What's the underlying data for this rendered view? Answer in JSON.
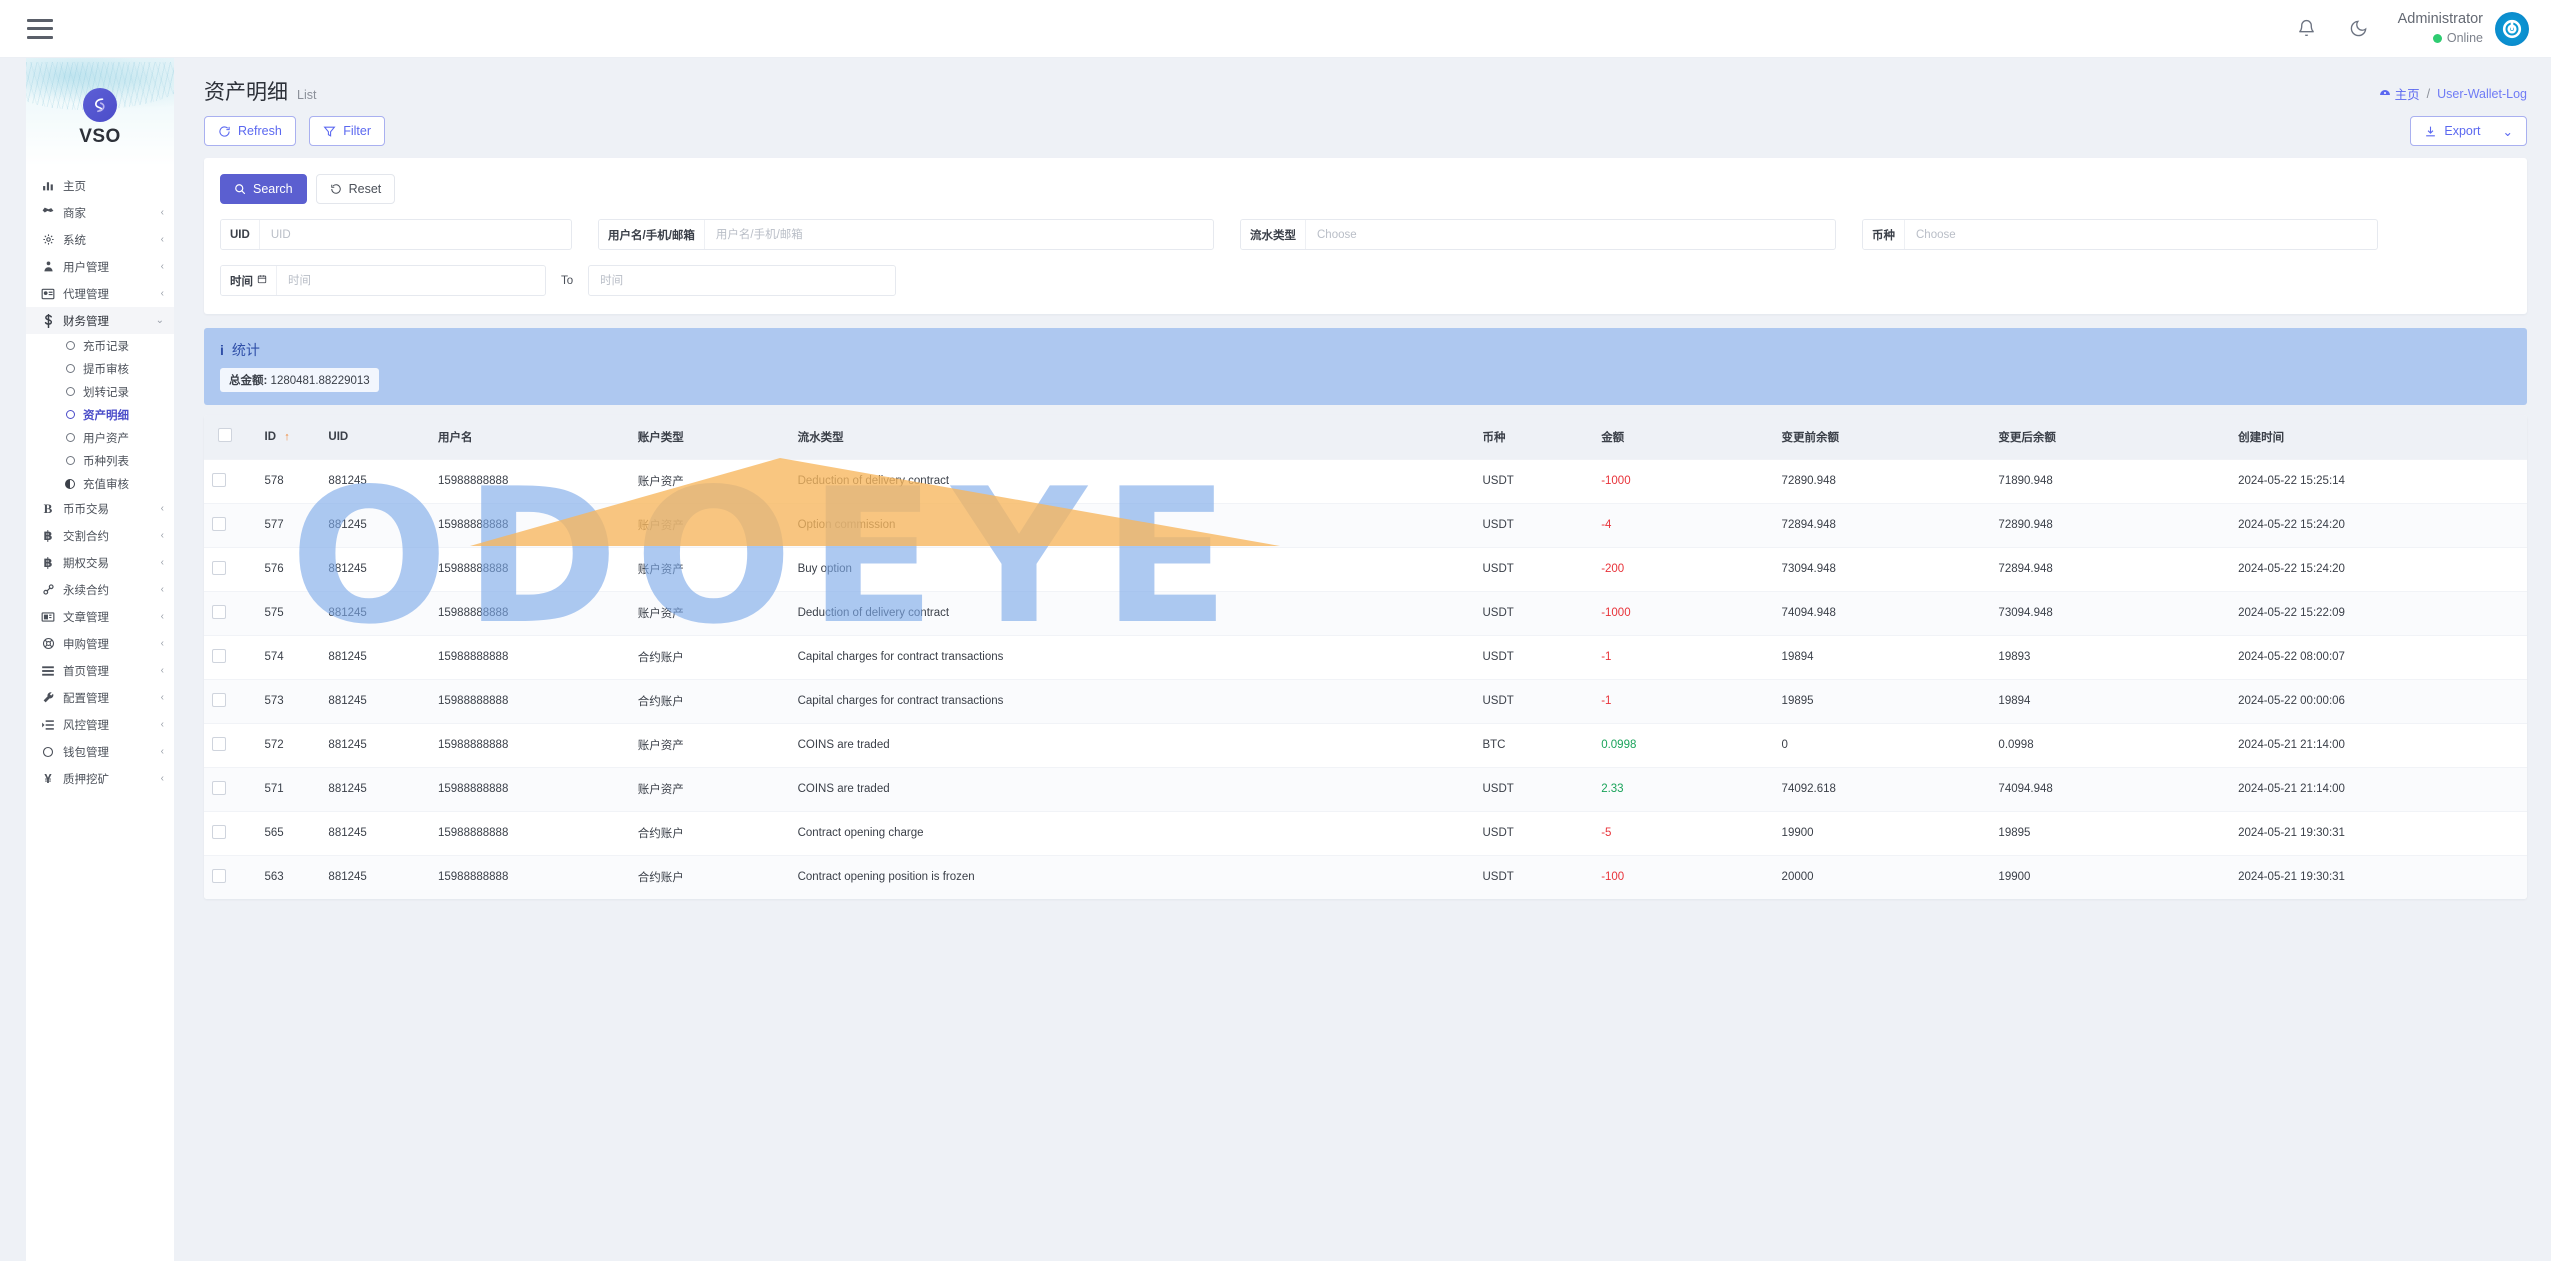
{
  "topbar": {
    "menu_icon": "hamburger-icon",
    "bell_icon": "bell-icon",
    "theme_icon": "moon-icon",
    "user_name": "Administrator",
    "user_status": "Online"
  },
  "sidebar": {
    "logo_text": "VSO",
    "items": [
      {
        "label": "主页",
        "icon": "chart-bars-icon",
        "expandable": false
      },
      {
        "label": "商家",
        "icon": "store-icon",
        "expandable": true
      },
      {
        "label": "系统",
        "icon": "gear-icon",
        "expandable": true
      },
      {
        "label": "用户管理",
        "icon": "user-tie-icon",
        "expandable": true
      },
      {
        "label": "代理管理",
        "icon": "id-card-icon",
        "expandable": true
      },
      {
        "label": "财务管理",
        "icon": "dollar-icon",
        "expandable": true,
        "active": true
      },
      {
        "label": "币币交易",
        "icon": "b-icon",
        "expandable": true
      },
      {
        "label": "交割合约",
        "icon": "bitcoin-icon",
        "expandable": true
      },
      {
        "label": "期权交易",
        "icon": "bitcoin-icon",
        "expandable": true
      },
      {
        "label": "永续合约",
        "icon": "link-icon",
        "expandable": true
      },
      {
        "label": "文章管理",
        "icon": "newspaper-icon",
        "expandable": true
      },
      {
        "label": "申购管理",
        "icon": "lifebuoy-icon",
        "expandable": true
      },
      {
        "label": "首页管理",
        "icon": "list-icon",
        "expandable": true
      },
      {
        "label": "配置管理",
        "icon": "wrench-icon",
        "expandable": true
      },
      {
        "label": "风控管理",
        "icon": "indent-icon",
        "expandable": true
      },
      {
        "label": "钱包管理",
        "icon": "circle-icon",
        "expandable": true
      },
      {
        "label": "质押挖矿",
        "icon": "yen-icon",
        "expandable": true
      }
    ],
    "finance_sub_items": [
      {
        "label": "充币记录",
        "icon": "circle-icon",
        "current": false
      },
      {
        "label": "提币审核",
        "icon": "circle-icon",
        "current": false
      },
      {
        "label": "划转记录",
        "icon": "circle-icon",
        "current": false
      },
      {
        "label": "资产明细",
        "icon": "circle-icon",
        "current": true
      },
      {
        "label": "用户资产",
        "icon": "circle-icon",
        "current": false
      },
      {
        "label": "币种列表",
        "icon": "circle-icon",
        "current": false
      },
      {
        "label": "充值审核",
        "icon": "half-circle-icon",
        "current": false
      }
    ]
  },
  "page": {
    "title": "资产明细",
    "subtitle": "List",
    "breadcrumb_home": "主页",
    "breadcrumb_current": "User-Wallet-Log",
    "refresh_label": "Refresh",
    "filter_label": "Filter",
    "export_label": "Export"
  },
  "search": {
    "search_label": "Search",
    "reset_label": "Reset",
    "fields": {
      "uid_label": "UID",
      "uid_placeholder": "UID",
      "uid_value": "",
      "user_label": "用户名/手机/邮箱",
      "user_placeholder": "用户名/手机/邮箱",
      "user_value": "",
      "flowtype_label": "流水类型",
      "flowtype_placeholder": "Choose",
      "flowtype_value": "",
      "coin_label": "币种",
      "coin_placeholder": "Choose",
      "coin_value": "",
      "time_label": "时间",
      "time_placeholder": "时间",
      "time_value": "",
      "to_label": "To",
      "time2_placeholder": "时间",
      "time2_value": ""
    }
  },
  "stats": {
    "title": "统计",
    "total_label": "总金额:",
    "total_value": "1280481.88229013"
  },
  "table": {
    "columns": [
      {
        "key": "check",
        "label": ""
      },
      {
        "key": "id",
        "label": "ID",
        "sorted": "asc"
      },
      {
        "key": "uid",
        "label": "UID"
      },
      {
        "key": "username",
        "label": "用户名"
      },
      {
        "key": "account_type",
        "label": "账户类型"
      },
      {
        "key": "flow_type",
        "label": "流水类型"
      },
      {
        "key": "coin",
        "label": "币种"
      },
      {
        "key": "amount",
        "label": "金额"
      },
      {
        "key": "balance_before",
        "label": "变更前余额"
      },
      {
        "key": "balance_after",
        "label": "变更后余额"
      },
      {
        "key": "created_at",
        "label": "创建时间"
      }
    ],
    "rows": [
      {
        "id": "578",
        "uid": "881245",
        "username": "15988888888",
        "account_type": "账户资产",
        "flow_type": "Deduction of delivery contract",
        "coin": "USDT",
        "amount": "-1000",
        "amount_sign": "neg",
        "balance_before": "72890.948",
        "balance_after": "71890.948",
        "created_at": "2024-05-22 15:25:14"
      },
      {
        "id": "577",
        "uid": "881245",
        "username": "15988888888",
        "account_type": "账户资产",
        "flow_type": "Option commission",
        "coin": "USDT",
        "amount": "-4",
        "amount_sign": "neg",
        "balance_before": "72894.948",
        "balance_after": "72890.948",
        "created_at": "2024-05-22 15:24:20"
      },
      {
        "id": "576",
        "uid": "881245",
        "username": "15988888888",
        "account_type": "账户资产",
        "flow_type": "Buy option",
        "coin": "USDT",
        "amount": "-200",
        "amount_sign": "neg",
        "balance_before": "73094.948",
        "balance_after": "72894.948",
        "created_at": "2024-05-22 15:24:20"
      },
      {
        "id": "575",
        "uid": "881245",
        "username": "15988888888",
        "account_type": "账户资产",
        "flow_type": "Deduction of delivery contract",
        "coin": "USDT",
        "amount": "-1000",
        "amount_sign": "neg",
        "balance_before": "74094.948",
        "balance_after": "73094.948",
        "created_at": "2024-05-22 15:22:09"
      },
      {
        "id": "574",
        "uid": "881245",
        "username": "15988888888",
        "account_type": "合约账户",
        "flow_type": "Capital charges for contract transactions",
        "coin": "USDT",
        "amount": "-1",
        "amount_sign": "neg",
        "balance_before": "19894",
        "balance_after": "19893",
        "created_at": "2024-05-22 08:00:07"
      },
      {
        "id": "573",
        "uid": "881245",
        "username": "15988888888",
        "account_type": "合约账户",
        "flow_type": "Capital charges for contract transactions",
        "coin": "USDT",
        "amount": "-1",
        "amount_sign": "neg",
        "balance_before": "19895",
        "balance_after": "19894",
        "created_at": "2024-05-22 00:00:06"
      },
      {
        "id": "572",
        "uid": "881245",
        "username": "15988888888",
        "account_type": "账户资产",
        "flow_type": "COINS are traded",
        "coin": "BTC",
        "amount": "0.0998",
        "amount_sign": "pos",
        "balance_before": "0",
        "balance_after": "0.0998",
        "created_at": "2024-05-21 21:14:00"
      },
      {
        "id": "571",
        "uid": "881245",
        "username": "15988888888",
        "account_type": "账户资产",
        "flow_type": "COINS are traded",
        "coin": "USDT",
        "amount": "2.33",
        "amount_sign": "pos",
        "balance_before": "74092.618",
        "balance_after": "74094.948",
        "created_at": "2024-05-21 21:14:00"
      },
      {
        "id": "565",
        "uid": "881245",
        "username": "15988888888",
        "account_type": "合约账户",
        "flow_type": "Contract opening charge",
        "coin": "USDT",
        "amount": "-5",
        "amount_sign": "neg",
        "balance_before": "19900",
        "balance_after": "19895",
        "created_at": "2024-05-21 19:30:31"
      },
      {
        "id": "563",
        "uid": "881245",
        "username": "15988888888",
        "account_type": "合约账户",
        "flow_type": "Contract opening position is frozen",
        "coin": "USDT",
        "amount": "-100",
        "amount_sign": "neg",
        "balance_before": "20000",
        "balance_after": "19900",
        "created_at": "2024-05-21 19:30:31"
      }
    ]
  },
  "watermark": {
    "text": "ODOEYE"
  },
  "colors": {
    "primary": "#5b5fd0",
    "link": "#5b68f0",
    "negative": "#e8333a",
    "positive": "#1aa35a",
    "stats_bg": "#aec8f0",
    "watermark": "rgba(122,168,232,.62)"
  }
}
